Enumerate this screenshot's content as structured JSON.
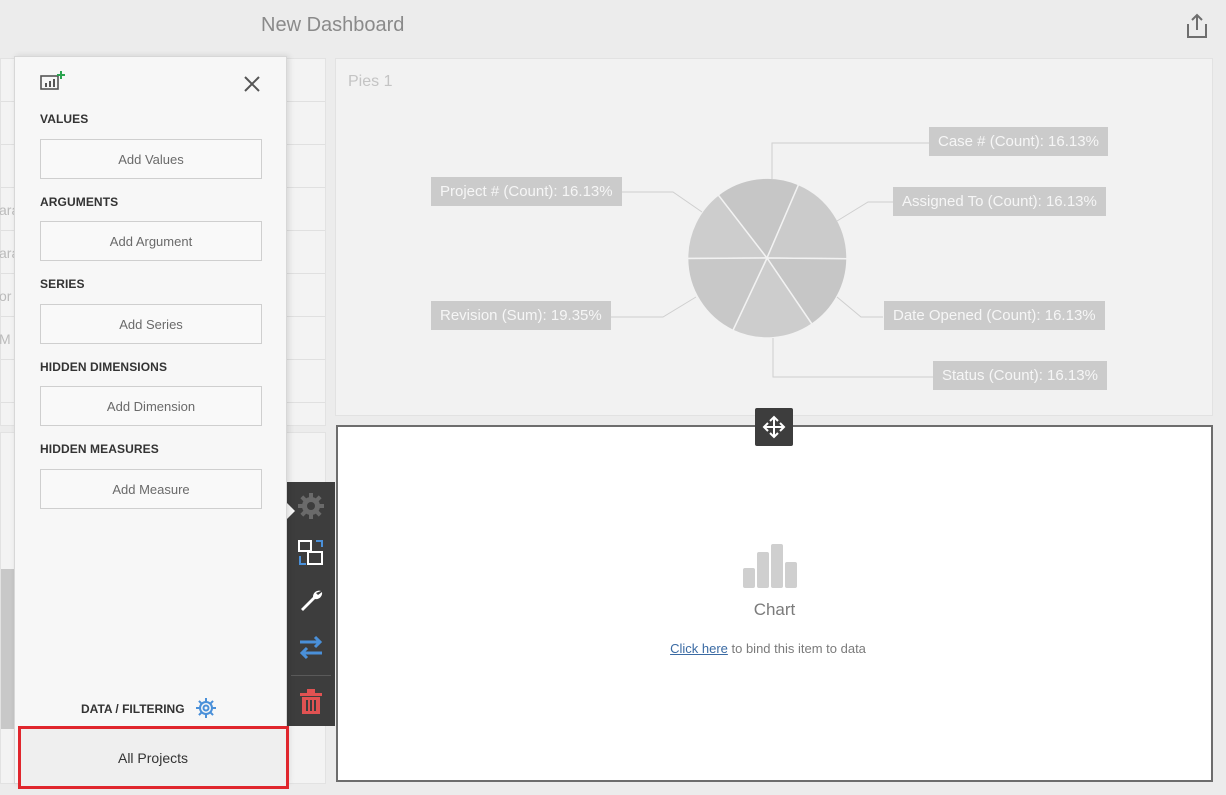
{
  "header": {
    "title": "New Dashboard",
    "share_icon": "share-icon"
  },
  "background_grid": {
    "row_fragments": [
      "",
      "",
      "",
      "ara",
      "ara",
      "or",
      "M",
      "",
      ""
    ]
  },
  "pie_item": {
    "caption": "Pies 1",
    "labels": {
      "case": "Case # (Count): 16.13%",
      "project": "Project # (Count): 16.13%",
      "assigned": "Assigned To (Count): 16.13%",
      "revision": "Revision (Sum): 19.35%",
      "date_opened": "Date Opened (Count): 16.13%",
      "status": "Status (Count): 16.13%"
    },
    "colors": {
      "slice": "#cbcbcb",
      "label_bg": "#cbcbcb",
      "leader": "#cfcfcf"
    }
  },
  "chart_item": {
    "title": "Chart",
    "bind_link": "Click here",
    "bind_text": "to bind this item to data"
  },
  "binding_panel": {
    "sections": {
      "values": {
        "label": "VALUES",
        "button": "Add Values"
      },
      "arguments": {
        "label": "ARGUMENTS",
        "button": "Add Argument"
      },
      "series": {
        "label": "SERIES",
        "button": "Add Series"
      },
      "hidden_dimensions": {
        "label": "HIDDEN DIMENSIONS",
        "button": "Add Dimension"
      },
      "hidden_measures": {
        "label": "HIDDEN MEASURES",
        "button": "Add Measure"
      }
    },
    "data_filtering_label": "DATA / FILTERING",
    "data_source": "All Projects"
  },
  "toolbar": {
    "icons": [
      "gear-icon",
      "convert-icon",
      "wrench-icon",
      "swap-icon",
      "trash-icon"
    ]
  },
  "colors": {
    "accent_blue": "#4a90d9",
    "delete_red": "#e05252",
    "highlight_red": "#e0262d",
    "add_green": "#2aa44f",
    "toolbar_bg": "#3d3d3d"
  }
}
